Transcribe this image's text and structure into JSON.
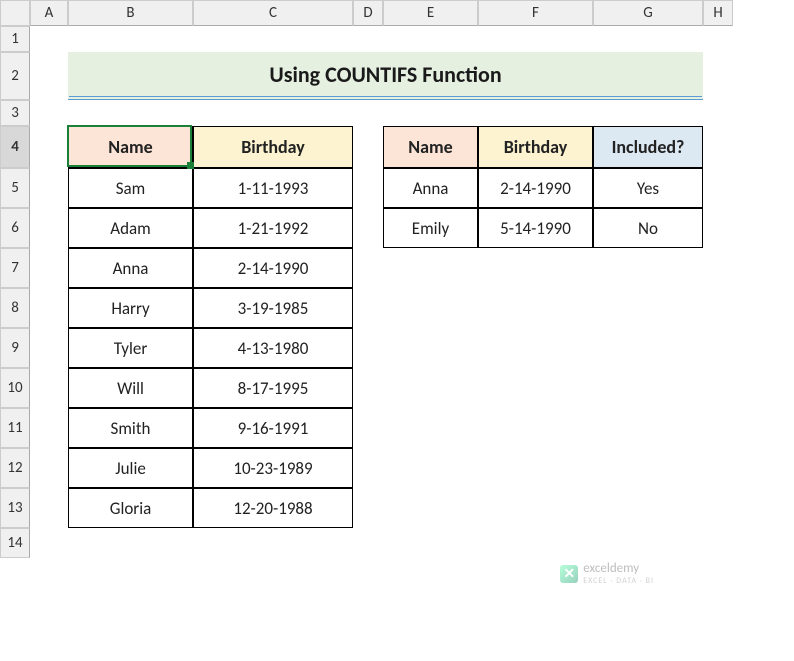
{
  "columns": [
    "A",
    "B",
    "C",
    "D",
    "E",
    "F",
    "G",
    "H"
  ],
  "rows": [
    "1",
    "2",
    "3",
    "4",
    "5",
    "6",
    "7",
    "8",
    "9",
    "10",
    "11",
    "12",
    "13",
    "14"
  ],
  "title": "Using COUNTIFS Function",
  "table1": {
    "headers": {
      "name": "Name",
      "birthday": "Birthday"
    },
    "rows": [
      {
        "name": "Sam",
        "birthday": "1-11-1993"
      },
      {
        "name": "Adam",
        "birthday": "1-21-1992"
      },
      {
        "name": "Anna",
        "birthday": "2-14-1990"
      },
      {
        "name": "Harry",
        "birthday": "3-19-1985"
      },
      {
        "name": "Tyler",
        "birthday": "4-13-1980"
      },
      {
        "name": "Will",
        "birthday": "8-17-1995"
      },
      {
        "name": "Smith",
        "birthday": "9-16-1991"
      },
      {
        "name": "Julie",
        "birthday": "10-23-1989"
      },
      {
        "name": "Gloria",
        "birthday": "12-20-1988"
      }
    ]
  },
  "table2": {
    "headers": {
      "name": "Name",
      "birthday": "Birthday",
      "included": "Included?"
    },
    "rows": [
      {
        "name": "Anna",
        "birthday": "2-14-1990",
        "included": "Yes"
      },
      {
        "name": "Emily",
        "birthday": "5-14-1990",
        "included": "No"
      }
    ]
  },
  "watermark": {
    "brand": "exceldemy",
    "tagline": "EXCEL · DATA · BI"
  },
  "active_cell": "B4",
  "chart_data": {
    "type": "table",
    "tables": [
      {
        "columns": [
          "Name",
          "Birthday"
        ],
        "rows": [
          [
            "Sam",
            "1-11-1993"
          ],
          [
            "Adam",
            "1-21-1992"
          ],
          [
            "Anna",
            "2-14-1990"
          ],
          [
            "Harry",
            "3-19-1985"
          ],
          [
            "Tyler",
            "4-13-1980"
          ],
          [
            "Will",
            "8-17-1995"
          ],
          [
            "Smith",
            "9-16-1991"
          ],
          [
            "Julie",
            "10-23-1989"
          ],
          [
            "Gloria",
            "12-20-1988"
          ]
        ]
      },
      {
        "columns": [
          "Name",
          "Birthday",
          "Included?"
        ],
        "rows": [
          [
            "Anna",
            "2-14-1990",
            "Yes"
          ],
          [
            "Emily",
            "5-14-1990",
            "No"
          ]
        ]
      }
    ]
  }
}
